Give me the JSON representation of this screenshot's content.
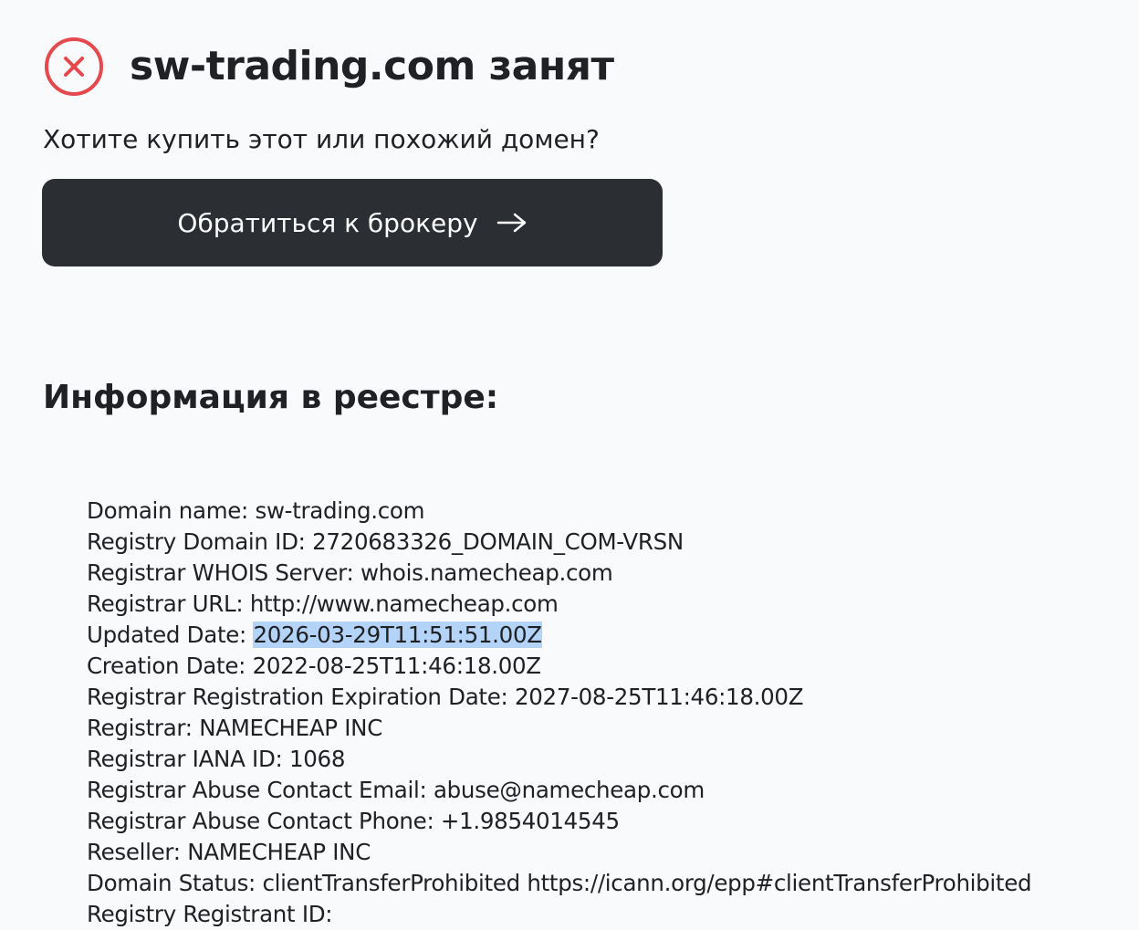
{
  "header": {
    "status_icon": "close-circle-icon",
    "status_color": "#e5484d",
    "title": "sw-trading.com занят"
  },
  "subtitle": "Хотите купить этот или похожий домен?",
  "broker_button": {
    "label": "Обратиться к брокеру",
    "icon": "arrow-right-icon",
    "background": "#2b2e33"
  },
  "section_heading": "Информация в реестре:",
  "whois": [
    {
      "label": "Domain name: ",
      "value": "sw-trading.com"
    },
    {
      "label": "Registry Domain ID: ",
      "value": "2720683326_DOMAIN_COM-VRSN"
    },
    {
      "label": "Registrar WHOIS Server: ",
      "value": "whois.namecheap.com"
    },
    {
      "label": "Registrar URL: ",
      "value": "http://www.namecheap.com"
    },
    {
      "label": "Updated Date: ",
      "value": "2026-03-29T11:51:51.00Z"
    },
    {
      "label": "Creation Date: ",
      "value": "2022-08-25T11:46:18.00Z"
    },
    {
      "label": "Registrar Registration Expiration Date: ",
      "value": "2027-08-25T11:46:18.00Z"
    },
    {
      "label": "Registrar: ",
      "value": "NAMECHEAP INC"
    },
    {
      "label": "Registrar IANA ID: ",
      "value": "1068"
    },
    {
      "label": "Registrar Abuse Contact Email: ",
      "value": "abuse@namecheap.com"
    },
    {
      "label": "Registrar Abuse Contact Phone: ",
      "value": "+1.9854014545"
    },
    {
      "label": "Reseller: ",
      "value": "NAMECHEAP INC"
    },
    {
      "label": "Domain Status: ",
      "value": "clientTransferProhibited https://icann.org/epp#clientTransferProhibited"
    },
    {
      "label": "Registry Registrant ID: ",
      "value": ""
    }
  ],
  "selection_color": "#b4d3f8"
}
